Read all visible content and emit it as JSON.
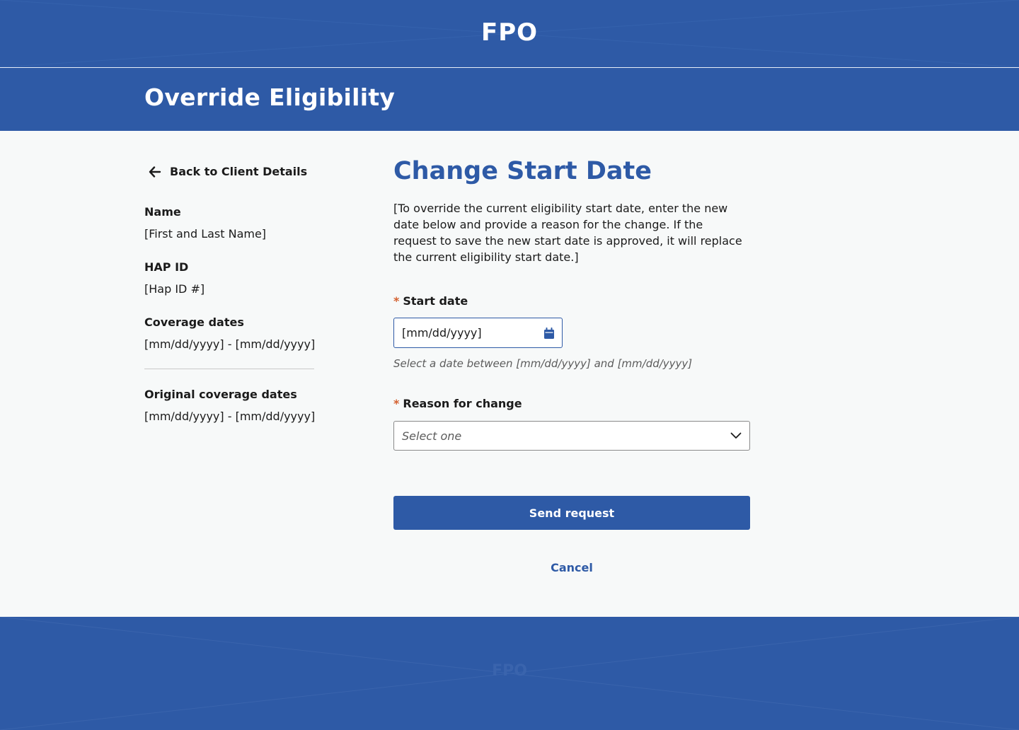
{
  "header": {
    "logo_text": "FPO"
  },
  "page": {
    "title": "Override Eligibility"
  },
  "sidebar": {
    "back_label": "Back to Client Details",
    "name_label": "Name",
    "name_value": "[First and Last Name]",
    "hap_label": "HAP ID",
    "hap_value": "[Hap ID #]",
    "coverage_label": "Coverage dates",
    "coverage_value": "[mm/dd/yyyy] - [mm/dd/yyyy]",
    "original_label": "Original coverage dates",
    "original_value": "[mm/dd/yyyy] - [mm/dd/yyyy]"
  },
  "form": {
    "title": "Change Start Date",
    "intro": "[To override the current eligibility start date, enter the new date below and provide a reason for the change. If the request to save the new start date is approved, it will replace the current eligibility start date.]",
    "required_marker": "*",
    "start_date_label": "Start date",
    "start_date_value": "[mm/dd/yyyy]",
    "start_date_hint": "Select a date between [mm/dd/yyyy] and [mm/dd/yyyy]",
    "reason_label": "Reason for change",
    "reason_value": "Select one",
    "send_label": "Send request",
    "cancel_label": "Cancel"
  },
  "footer": {
    "placeholder_text": "FPO"
  },
  "colors": {
    "brand_blue": "#2e5aa6",
    "required_orange": "#d4602f",
    "page_background": "#f7f9f9"
  },
  "icons": {
    "back": "arrow-left-icon",
    "calendar": "calendar-icon",
    "dropdown": "chevron-down-icon"
  }
}
